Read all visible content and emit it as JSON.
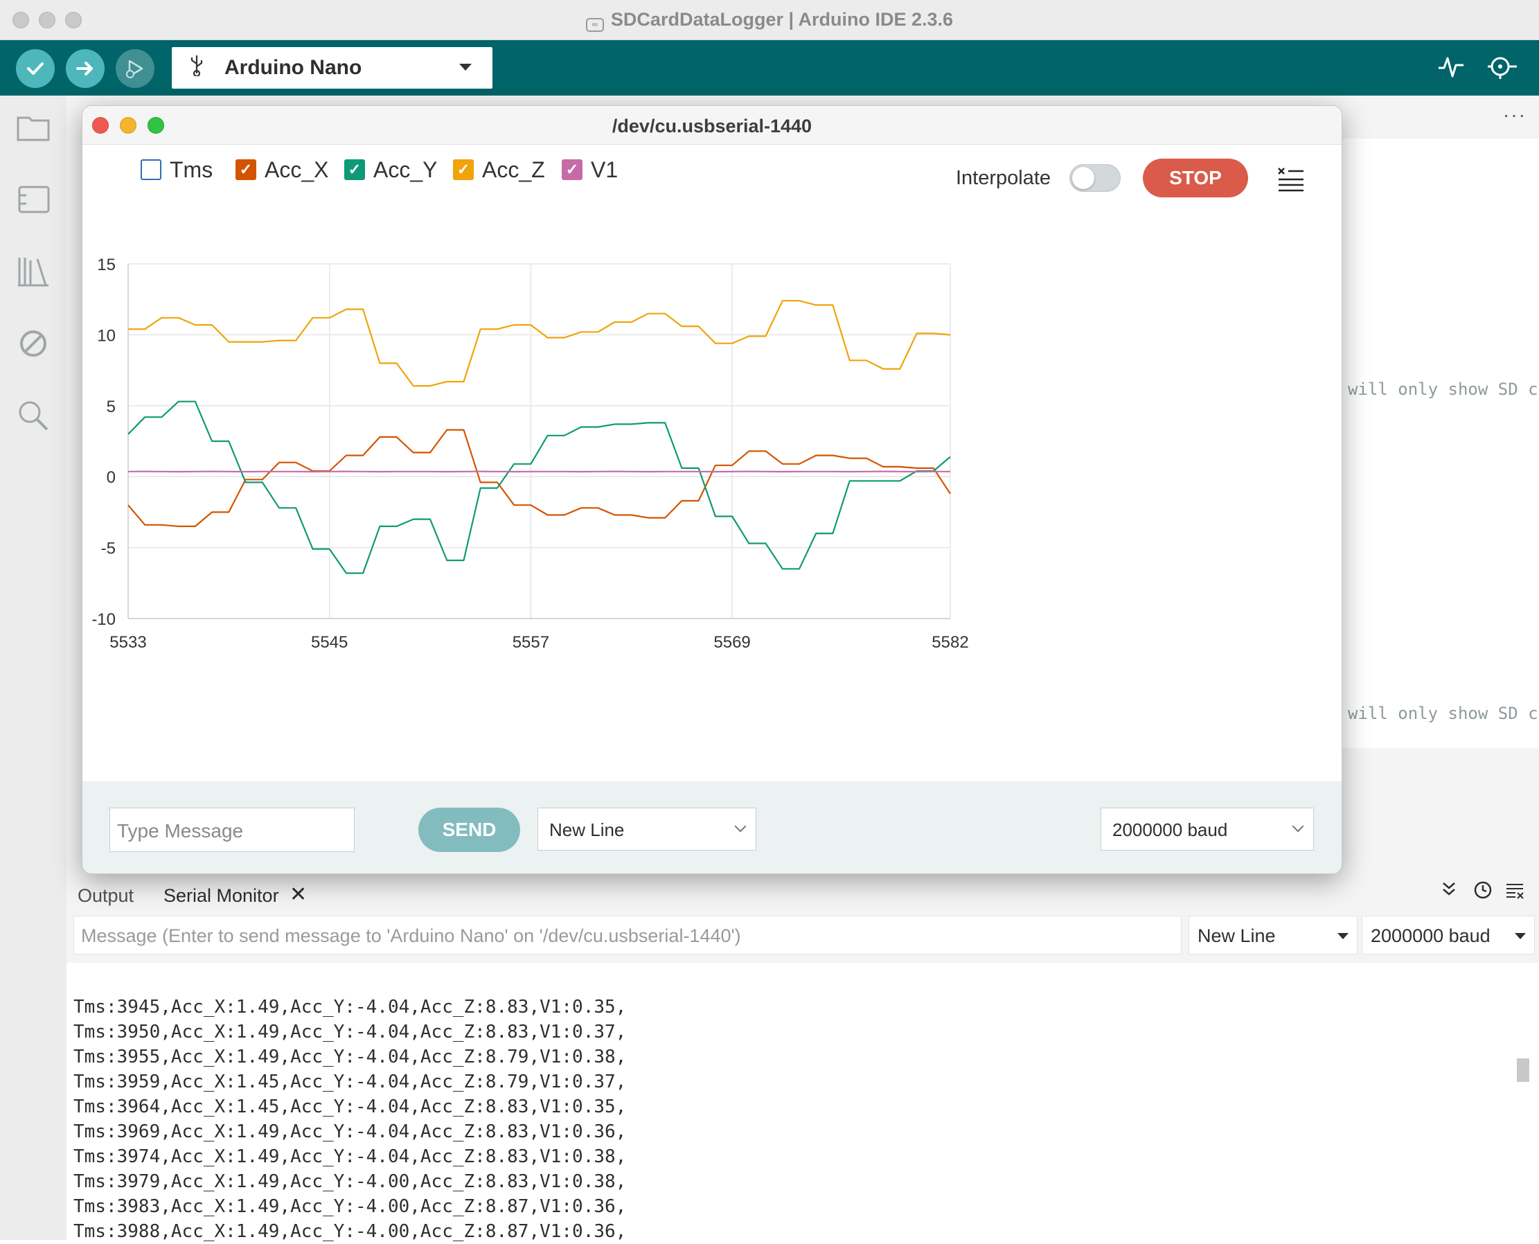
{
  "window": {
    "title": "SDCardDataLogger | Arduino IDE 2.3.6"
  },
  "toolbar": {
    "board": "Arduino Nano",
    "verify_icon": "check-icon",
    "upload_icon": "arrow-right-icon",
    "debug_icon": "debug-icon",
    "plotter_icon": "serial-plotter-icon",
    "monitor_icon": "serial-monitor-icon"
  },
  "sidebar": {
    "items": [
      "folder-icon",
      "board-manager-icon",
      "library-icon",
      "debug-disabled-icon",
      "search-icon"
    ]
  },
  "editor": {
    "ghost_lines": [
      "will only show SD c",
      "will only show SD c"
    ],
    "more": "···"
  },
  "plotter": {
    "title": "/dev/cu.usbserial-1440",
    "legend": [
      {
        "label": "Tms",
        "checked": false,
        "color": "#2f6fae"
      },
      {
        "label": "Acc_X",
        "checked": true,
        "color": "#d35400"
      },
      {
        "label": "Acc_Y",
        "checked": true,
        "color": "#0e9a76"
      },
      {
        "label": "Acc_Z",
        "checked": true,
        "color": "#f0a30a"
      },
      {
        "label": "V1",
        "checked": true,
        "color": "#c76ba8"
      }
    ],
    "interpolate_label": "Interpolate",
    "interpolate_on": false,
    "stop_label": "STOP",
    "message_placeholder": "Type Message",
    "send_label": "SEND",
    "line_ending": "New Line",
    "baud": "2000000 baud"
  },
  "chart_data": {
    "type": "line",
    "x": [
      5533,
      5534,
      5535,
      5536,
      5537,
      5538,
      5539,
      5540,
      5541,
      5542,
      5543,
      5544,
      5545,
      5546,
      5547,
      5548,
      5549,
      5550,
      5551,
      5552,
      5553,
      5554,
      5555,
      5556,
      5557,
      5558,
      5559,
      5560,
      5561,
      5562,
      5563,
      5564,
      5565,
      5566,
      5567,
      5568,
      5569,
      5570,
      5571,
      5572,
      5573,
      5574,
      5575,
      5576,
      5577,
      5578,
      5579,
      5580,
      5581,
      5582
    ],
    "xticks": [
      5533,
      5545,
      5557,
      5569,
      5582
    ],
    "yticks": [
      15,
      10,
      5,
      0,
      -5,
      -10
    ],
    "ylim": [
      -10,
      15
    ],
    "grid": true,
    "series": [
      {
        "name": "Acc_X",
        "color": "#d35400",
        "values": [
          -2.0,
          -3.4,
          -3.4,
          -3.5,
          -3.5,
          -2.5,
          -2.5,
          -0.2,
          -0.2,
          1.0,
          1.0,
          0.4,
          0.4,
          1.5,
          1.5,
          2.8,
          2.8,
          1.7,
          1.7,
          3.3,
          3.3,
          -0.4,
          -0.4,
          -2.0,
          -2.0,
          -2.7,
          -2.7,
          -2.2,
          -2.2,
          -2.7,
          -2.7,
          -2.9,
          -2.9,
          -1.7,
          -1.7,
          0.8,
          0.8,
          1.8,
          1.8,
          0.9,
          0.9,
          1.5,
          1.5,
          1.3,
          1.3,
          0.7,
          0.7,
          0.6,
          0.6,
          -1.2
        ]
      },
      {
        "name": "Acc_Y",
        "color": "#0e9a76",
        "values": [
          3.0,
          4.2,
          4.2,
          5.3,
          5.3,
          2.5,
          2.5,
          -0.4,
          -0.4,
          -2.2,
          -2.2,
          -5.1,
          -5.1,
          -6.8,
          -6.8,
          -3.5,
          -3.5,
          -3.0,
          -3.0,
          -5.9,
          -5.9,
          -0.8,
          -0.8,
          0.9,
          0.9,
          2.9,
          2.9,
          3.5,
          3.5,
          3.7,
          3.7,
          3.8,
          3.8,
          0.6,
          0.6,
          -2.8,
          -2.8,
          -4.7,
          -4.7,
          -6.5,
          -6.5,
          -4.0,
          -4.0,
          -0.3,
          -0.3,
          -0.3,
          -0.3,
          0.4,
          0.4,
          1.4
        ]
      },
      {
        "name": "Acc_Z",
        "color": "#f0a30a",
        "values": [
          10.4,
          10.4,
          11.2,
          11.2,
          10.7,
          10.7,
          9.5,
          9.5,
          9.5,
          9.6,
          9.6,
          11.2,
          11.2,
          11.8,
          11.8,
          8.0,
          8.0,
          6.4,
          6.4,
          6.7,
          6.7,
          10.4,
          10.4,
          10.7,
          10.7,
          9.8,
          9.8,
          10.2,
          10.2,
          10.9,
          10.9,
          11.5,
          11.5,
          10.6,
          10.6,
          9.4,
          9.4,
          9.9,
          9.9,
          12.4,
          12.4,
          12.1,
          12.1,
          8.2,
          8.2,
          7.6,
          7.6,
          10.1,
          10.1,
          10.0
        ]
      },
      {
        "name": "V1",
        "color": "#c76ba8",
        "values": [
          0.36,
          0.37,
          0.36,
          0.35,
          0.36,
          0.37,
          0.36,
          0.35,
          0.36,
          0.36,
          0.36,
          0.35,
          0.36,
          0.37,
          0.36,
          0.35,
          0.36,
          0.36,
          0.36,
          0.35,
          0.36,
          0.37,
          0.36,
          0.35,
          0.36,
          0.36,
          0.36,
          0.35,
          0.36,
          0.37,
          0.36,
          0.35,
          0.36,
          0.36,
          0.36,
          0.35,
          0.36,
          0.37,
          0.36,
          0.35,
          0.36,
          0.36,
          0.36,
          0.35,
          0.36,
          0.37,
          0.36,
          0.35,
          0.36,
          0.36
        ]
      }
    ]
  },
  "panel": {
    "tab_output": "Output",
    "tab_serial": "Serial Monitor",
    "tab_close": "✕",
    "message_placeholder": "Message (Enter to send message to 'Arduino Nano' on '/dev/cu.usbserial-1440')",
    "line_ending": "New Line",
    "baud": "2000000 baud",
    "log": [
      "Tms:3945,Acc_X:1.49,Acc_Y:-4.04,Acc_Z:8.83,V1:0.35,",
      "Tms:3950,Acc_X:1.49,Acc_Y:-4.04,Acc_Z:8.83,V1:0.37,",
      "Tms:3955,Acc_X:1.49,Acc_Y:-4.04,Acc_Z:8.79,V1:0.38,",
      "Tms:3959,Acc_X:1.45,Acc_Y:-4.04,Acc_Z:8.79,V1:0.37,",
      "Tms:3964,Acc_X:1.45,Acc_Y:-4.04,Acc_Z:8.83,V1:0.35,",
      "Tms:3969,Acc_X:1.49,Acc_Y:-4.04,Acc_Z:8.83,V1:0.36,",
      "Tms:3974,Acc_X:1.49,Acc_Y:-4.04,Acc_Z:8.83,V1:0.38,",
      "Tms:3979,Acc_X:1.49,Acc_Y:-4.00,Acc_Z:8.83,V1:0.38,",
      "Tms:3983,Acc_X:1.49,Acc_Y:-4.00,Acc_Z:8.87,V1:0.36,",
      "Tms:3988,Acc_X:1.49,Acc_Y:-4.00,Acc_Z:8.87,V1:0.36,"
    ]
  }
}
